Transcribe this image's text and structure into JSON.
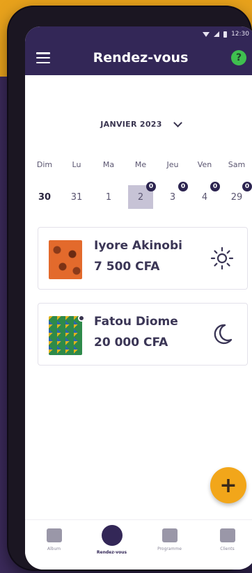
{
  "app": {
    "title": "Rendez-vous",
    "status_time": "12:30"
  },
  "calendar": {
    "month_label": "JANVIER 2023",
    "days": [
      "Dim",
      "Lu",
      "Ma",
      "Me",
      "Jeu",
      "Ven",
      "Sam"
    ],
    "dates": [
      {
        "label": "30",
        "bold": true,
        "badge": ""
      },
      {
        "label": "31",
        "bold": false,
        "badge": ""
      },
      {
        "label": "1",
        "bold": false,
        "badge": ""
      },
      {
        "label": "2",
        "bold": false,
        "badge": "0",
        "selected": true
      },
      {
        "label": "3",
        "bold": false,
        "badge": "0"
      },
      {
        "label": "4",
        "bold": false,
        "badge": "0"
      },
      {
        "label": "29",
        "bold": false,
        "badge": "0"
      }
    ]
  },
  "appointments": [
    {
      "name": "Iyore  Akinobi",
      "price": "7 500 CFA",
      "period_icon": "sun-icon"
    },
    {
      "name": "Fatou Diome",
      "price": "20 000 CFA",
      "period_icon": "moon-icon"
    }
  ],
  "bottom_nav": [
    {
      "label": "Album",
      "icon": "album-icon"
    },
    {
      "label": "Rendez-vous",
      "icon": "clock-icon",
      "active": true
    },
    {
      "label": "Programme",
      "icon": "layers-icon"
    },
    {
      "label": "Clients",
      "icon": "users-icon"
    }
  ],
  "colors": {
    "header": "#332757",
    "accent": "#f2a61a",
    "help": "#3fbf4f",
    "selected_date": "#c7c3d6"
  }
}
